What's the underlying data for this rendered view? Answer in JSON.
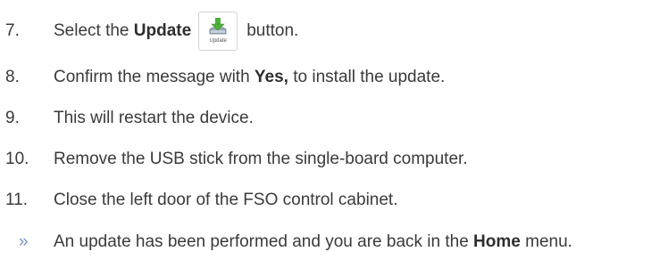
{
  "steps": [
    {
      "number": "7.",
      "before": "Select the ",
      "bold": "Update",
      "after": "button.",
      "button_caption": "Update",
      "icon": "download-to-tray-icon"
    },
    {
      "number": "8.",
      "before": "Confirm the message with ",
      "bold": "Yes,",
      "after": " to install the update."
    },
    {
      "number": "9.",
      "text": "This will restart the device."
    },
    {
      "number": "10.",
      "text": "Remove the USB stick from the single-board computer."
    },
    {
      "number": "11.",
      "text": "Close the left door of the FSO control cabinet."
    }
  ],
  "result": {
    "marker": "»",
    "before": "An update has been performed and you are back in the ",
    "bold": "Home",
    "after": " menu."
  },
  "colors": {
    "text": "#3a3a3a",
    "result_marker": "#7a96c4",
    "icon_arrow": "#4caf3a",
    "icon_tray": "#8a98a8"
  }
}
